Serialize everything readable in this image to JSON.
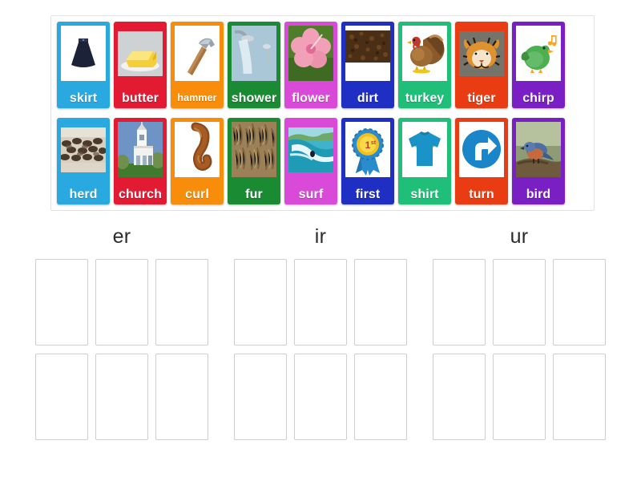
{
  "activity": {
    "type": "word-sort",
    "title": "er / ir / ur sort"
  },
  "card_tray": {
    "rows": [
      [
        {
          "word": "skirt",
          "color": "#29a9e0",
          "art": "skirt",
          "label_size": "normal",
          "thumb": "boxed"
        },
        {
          "word": "butter",
          "color": "#e21b33",
          "art": "butter",
          "label_size": "normal",
          "thumb": "bleed"
        },
        {
          "word": "hammer",
          "color": "#f78d0a",
          "art": "hammer",
          "label_size": "small",
          "thumb": "boxed"
        },
        {
          "word": "shower",
          "color": "#1a8a33",
          "art": "shower",
          "label_size": "normal",
          "thumb": "boxed"
        },
        {
          "word": "flower",
          "color": "#d94ad9",
          "art": "flower",
          "label_size": "normal",
          "thumb": "boxed"
        },
        {
          "word": "dirt",
          "color": "#1f2fc4",
          "art": "dirt",
          "label_size": "normal",
          "thumb": "boxed"
        },
        {
          "word": "turkey",
          "color": "#1fbf7a",
          "art": "turkey",
          "label_size": "normal",
          "thumb": "boxed"
        },
        {
          "word": "tiger",
          "color": "#ea3c12",
          "art": "tiger",
          "label_size": "normal",
          "thumb": "bleed"
        },
        {
          "word": "chirp",
          "color": "#7a1fc4",
          "art": "chirp",
          "label_size": "normal",
          "thumb": "boxed"
        }
      ],
      [
        {
          "word": "herd",
          "color": "#29a9e0",
          "art": "herd",
          "label_size": "normal",
          "thumb": "bleed"
        },
        {
          "word": "church",
          "color": "#e21b33",
          "art": "church",
          "label_size": "normal",
          "thumb": "boxed"
        },
        {
          "word": "curl",
          "color": "#f78d0a",
          "art": "curl",
          "label_size": "normal",
          "thumb": "boxed"
        },
        {
          "word": "fur",
          "color": "#1a8a33",
          "art": "fur",
          "label_size": "normal",
          "thumb": "boxed"
        },
        {
          "word": "surf",
          "color": "#d94ad9",
          "art": "surf",
          "label_size": "normal",
          "thumb": "bleed"
        },
        {
          "word": "first",
          "color": "#1f2fc4",
          "art": "first",
          "label_size": "normal",
          "thumb": "boxed"
        },
        {
          "word": "shirt",
          "color": "#1fbf7a",
          "art": "shirt",
          "label_size": "normal",
          "thumb": "boxed"
        },
        {
          "word": "turn",
          "color": "#ea3c12",
          "art": "turn",
          "label_size": "normal",
          "thumb": "boxed"
        },
        {
          "word": "bird",
          "color": "#7a1fc4",
          "art": "bird",
          "label_size": "normal",
          "thumb": "boxed"
        }
      ]
    ]
  },
  "categories": [
    {
      "title": "er",
      "slot_count": 6,
      "filled": []
    },
    {
      "title": "ir",
      "slot_count": 6,
      "filled": []
    },
    {
      "title": "ur",
      "slot_count": 6,
      "filled": []
    }
  ],
  "colors": {
    "page_background": "#ffffff",
    "tray_border": "#e3e3e3",
    "slot_border": "#cfcfcf",
    "category_text": "#2b2b2b",
    "card_label_text": "#ffffff"
  }
}
